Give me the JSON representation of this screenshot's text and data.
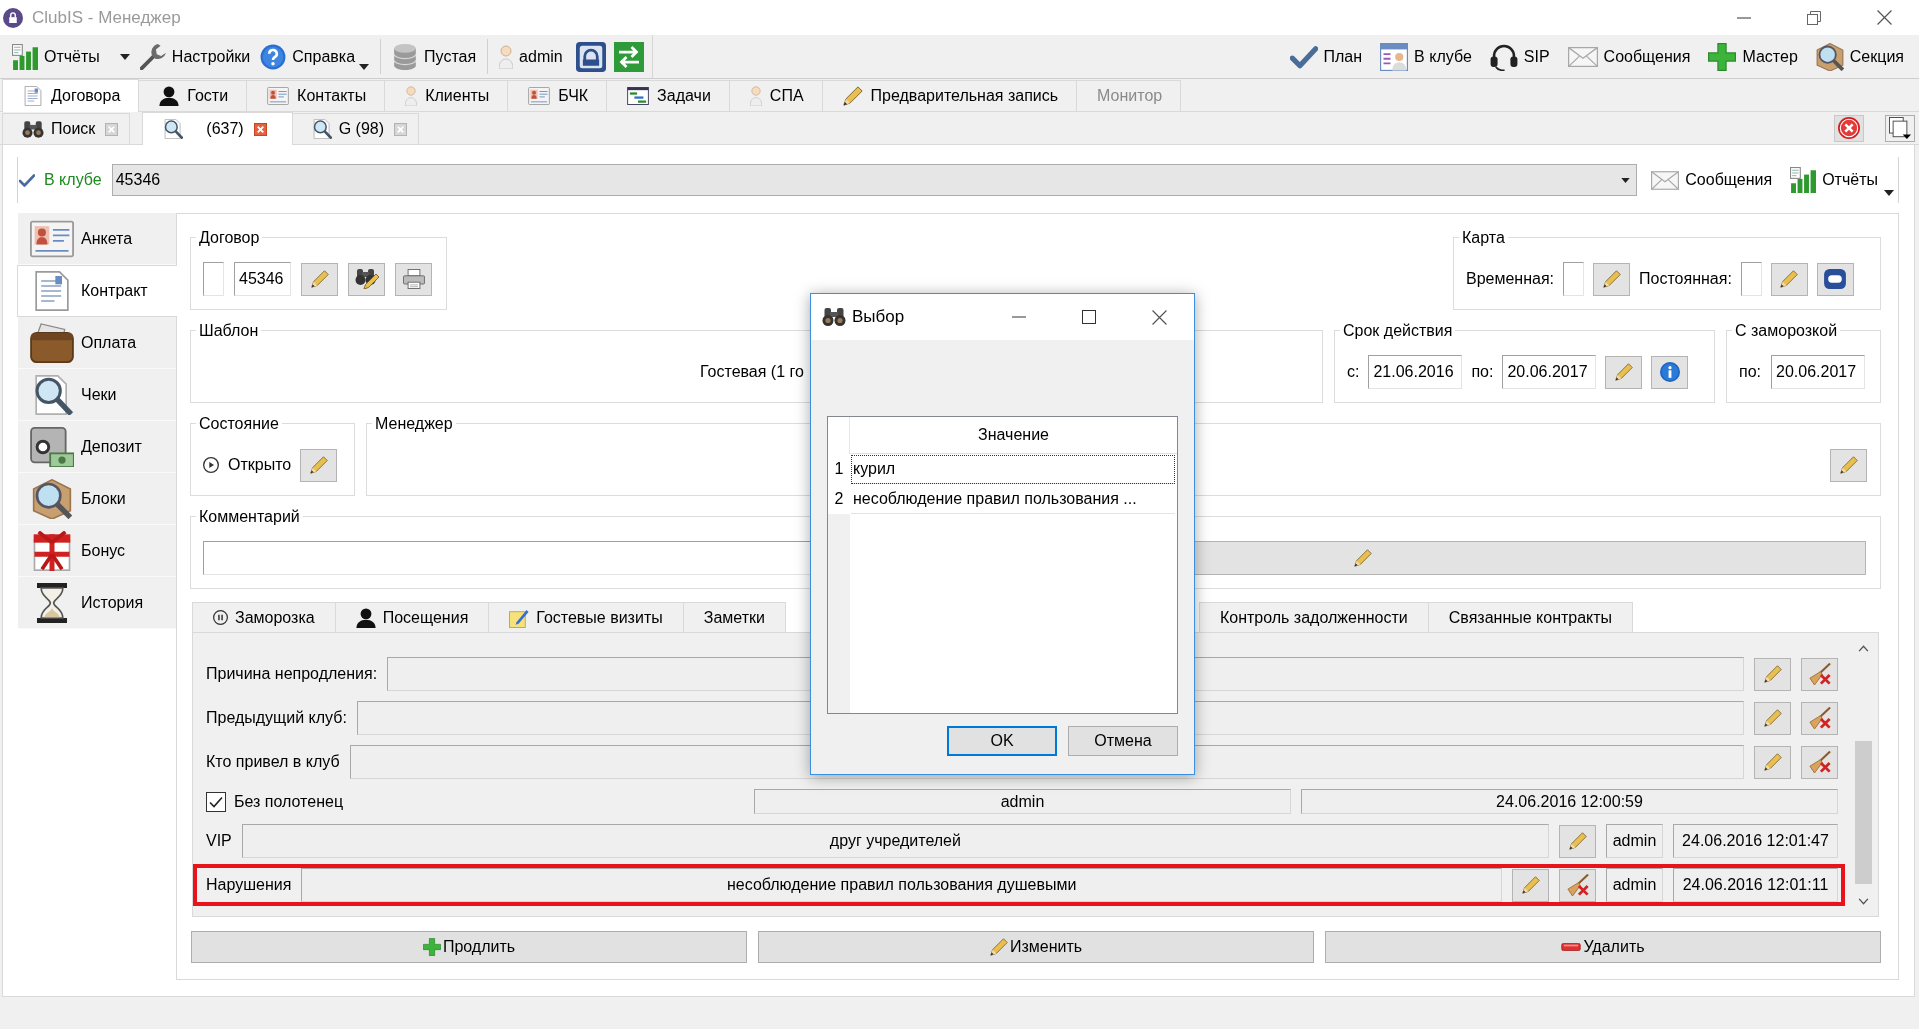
{
  "window": {
    "title": "ClubIS - Менеджер"
  },
  "toolbar": {
    "left_groups": [
      [
        {
          "label": "Отчёты",
          "dropdown": true
        },
        {
          "label": "Настройки",
          "dropdown": false
        },
        {
          "label": "Справка",
          "dropdown": true
        }
      ],
      [
        {
          "label": "Пустая",
          "dropdown": false
        }
      ],
      [
        {
          "label": "admin",
          "dropdown": false
        }
      ]
    ],
    "right_items": [
      {
        "label": "План"
      },
      {
        "label": "В клубе"
      },
      {
        "label": "SIP"
      },
      {
        "label": "Сообщения"
      },
      {
        "label": "Мастер"
      },
      {
        "label": "Секция"
      }
    ]
  },
  "main_tabs": [
    {
      "label": "Договора",
      "selected": true,
      "disabled": false
    },
    {
      "label": "Гости",
      "selected": false,
      "disabled": false
    },
    {
      "label": "Контакты",
      "selected": false,
      "disabled": false
    },
    {
      "label": "Клиенты",
      "selected": false,
      "disabled": false
    },
    {
      "label": "БЧК",
      "selected": false,
      "disabled": false
    },
    {
      "label": "Задачи",
      "selected": false,
      "disabled": false
    },
    {
      "label": "СПА",
      "selected": false,
      "disabled": false
    },
    {
      "label": "Предварительная запись",
      "selected": false,
      "disabled": false
    },
    {
      "label": "Монитор",
      "selected": false,
      "disabled": true
    }
  ],
  "sub_tabs": [
    {
      "label": "Поиск",
      "selected": false
    },
    {
      "label": "(637)",
      "selected": true
    },
    {
      "label": "G (98)",
      "selected": false
    }
  ],
  "club_bar": {
    "status": "В клубе",
    "value": "45346",
    "buttons": [
      {
        "label": "Сообщения",
        "dropdown": false
      },
      {
        "label": "Отчёты",
        "dropdown": true
      }
    ]
  },
  "sidebar": {
    "items": [
      {
        "label": "Анкета",
        "selected": false
      },
      {
        "label": "Контракт",
        "selected": true
      },
      {
        "label": "Оплата",
        "selected": false
      },
      {
        "label": "Чеки",
        "selected": false
      },
      {
        "label": "Депозит",
        "selected": false
      },
      {
        "label": "Блоки",
        "selected": false
      },
      {
        "label": "Бонус",
        "selected": false
      },
      {
        "label": "История",
        "selected": false
      }
    ]
  },
  "contract": {
    "title": "Договор",
    "number": "45346"
  },
  "card": {
    "title": "Карта",
    "temporary_label": "Временная:",
    "permanent_label": "Постоянная:"
  },
  "template": {
    "title": "Шаблон",
    "value": "Гостевая (1 го"
  },
  "validity": {
    "title": "Срок действия",
    "from_label": "с:",
    "from": "21.06.2016",
    "to_label": "по:",
    "to": "20.06.2017"
  },
  "freeze": {
    "title": "С заморозкой",
    "to_label": "по:",
    "to": "20.06.2017"
  },
  "state": {
    "title": "Состояние",
    "value": "Открыто"
  },
  "manager": {
    "title": "Менеджер"
  },
  "comment": {
    "title": "Комментарий"
  },
  "detail_tabs": [
    {
      "label": "Заморозка",
      "selected": false
    },
    {
      "label": "Посещения",
      "selected": false
    },
    {
      "label": "Гостевые визиты",
      "selected": false
    },
    {
      "label": "Заметки",
      "selected": false
    },
    {
      "label": "Контроль задолженности",
      "selected": false
    },
    {
      "label": "Связанные контракты",
      "selected": false
    }
  ],
  "detail_rows": [
    {
      "kind": "field",
      "label": "Причина непродления:",
      "highlighted": false
    },
    {
      "kind": "field",
      "label": "Предыдущий клуб:",
      "highlighted": false
    },
    {
      "kind": "field",
      "label": "Кто привел в клуб",
      "highlighted": false
    },
    {
      "kind": "checkbox",
      "label": "Без полотенец",
      "checked": true,
      "user": "admin",
      "time": "24.06.2016 12:00:59",
      "highlighted": false
    },
    {
      "kind": "record",
      "label": "VIP",
      "value": "друг учредителей",
      "clearable": false,
      "user": "admin",
      "time": "24.06.2016 12:01:47",
      "highlighted": false
    },
    {
      "kind": "record",
      "label": "Нарушения",
      "value": "несоблюдение правил пользования душевыми",
      "clearable": true,
      "user": "admin",
      "time": "24.06.2016 12:01:11",
      "highlighted": true
    }
  ],
  "actions": [
    {
      "label": "Продлить"
    },
    {
      "label": "Изменить"
    },
    {
      "label": "Удалить"
    }
  ],
  "dialog": {
    "title": "Выбор",
    "column": "Значение",
    "rows": [
      {
        "number": "1",
        "value": "курил",
        "selected": true
      },
      {
        "number": "2",
        "value": "несоблюдение правил пользования ...",
        "selected": false
      }
    ],
    "buttons": [
      {
        "label": "OK",
        "default": true
      },
      {
        "label": "Отмена",
        "default": false
      }
    ]
  }
}
